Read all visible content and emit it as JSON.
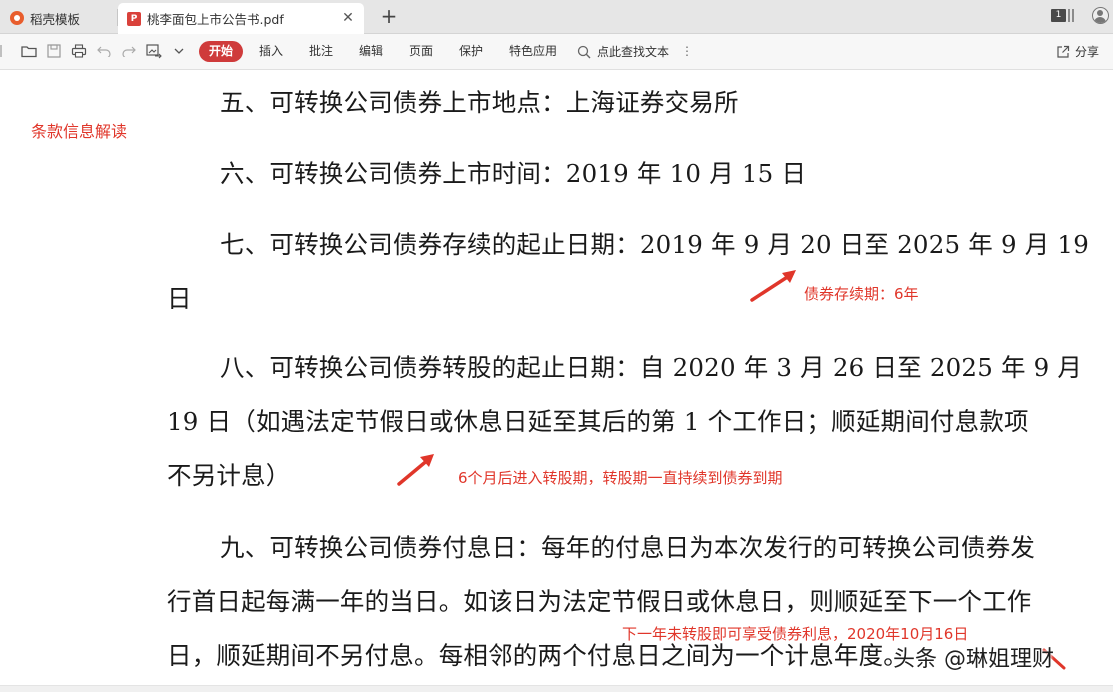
{
  "tabs": [
    {
      "label": "稻壳模板",
      "icon": "wps-logo-icon",
      "active": false
    },
    {
      "label": "桃李面包上市公告书.pdf",
      "icon": "pdf-file-icon",
      "active": true
    }
  ],
  "tab_count": "1",
  "toolbar": {
    "menu": [
      "开始",
      "插入",
      "批注",
      "编辑",
      "页面",
      "保护",
      "特色应用"
    ],
    "search_label": "点此查找文本",
    "share_label": "分享"
  },
  "document": {
    "sidebar_note": "条款信息解读",
    "paragraphs": {
      "p5": [
        "五、可转换公司债券上市地点：上海证券交易所"
      ],
      "p6": [
        "六、可转换公司债券上市时间：2019 年 10 月 15 日"
      ],
      "p7": [
        "七、可转换公司债券存续的起止日期：2019 年 9 月 20 日至 2025 年 9 月 19",
        "日"
      ],
      "p8": [
        "八、可转换公司债券转股的起止日期：自 2020 年 3 月 26 日至 2025 年 9 月",
        "19 日（如遇法定节假日或休息日延至其后的第 1 个工作日；顺延期间付息款项",
        "不另计息）"
      ],
      "p9": [
        "九、可转换公司债券付息日：每年的付息日为本次发行的可转换公司债券发",
        "行首日起每满一年的当日。如该日为法定节假日或休息日，则顺延至下一个工作",
        "日，顺延期间不另付息。每相邻的两个付息日之间为一个计息年度。"
      ]
    },
    "annotations": {
      "duration": "债券存续期：6年",
      "conversion": "6个月后进入转股期，转股期一直持续到债券到期",
      "interest": "下一年未转股即可享受债券利息，2020年10月16日"
    },
    "watermark": "头条 @琳姐理财",
    "accent_color": "#e0362a"
  }
}
